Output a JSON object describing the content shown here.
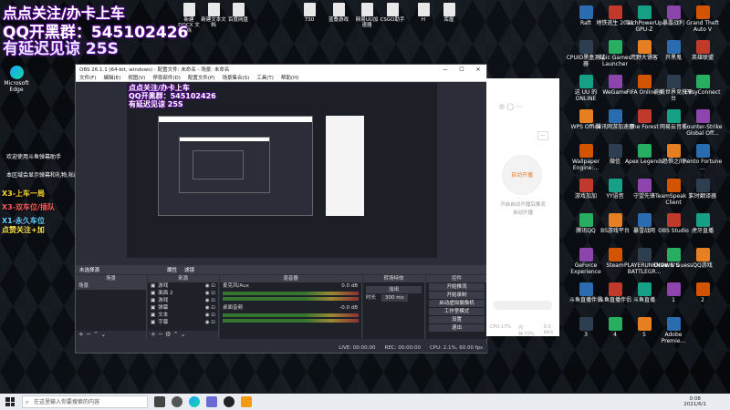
{
  "overlay": {
    "line1": "点点关注/办卡上车",
    "line2": "QQ开黑群：545102426",
    "line3": "有延迟见谅 25S"
  },
  "top_files": [
    {
      "label": "新建 DOCX 文档"
    },
    {
      "label": "新建文本文档"
    },
    {
      "label": "百度网盘"
    },
    {
      "label": "730"
    },
    {
      "label": "蓝叠游戏"
    },
    {
      "label": "网易UU加速器"
    },
    {
      "label": "CSGO助手"
    },
    {
      "label": "H"
    },
    {
      "label": "库屋"
    }
  ],
  "left_icons": [
    {
      "label": "Microsoft Edge"
    }
  ],
  "right_icons": [
    {
      "label": "Raft"
    },
    {
      "label": "地铁逃生 2021"
    },
    {
      "label": "TechPowerUp GPU-Z"
    },
    {
      "label": "暴露战利"
    },
    {
      "label": "Grand Theft Auto V"
    },
    {
      "label": "CPUID黑盒测试器"
    },
    {
      "label": "Epic Games Launcher"
    },
    {
      "label": "荒野大镖客"
    },
    {
      "label": "开黑鬼"
    },
    {
      "label": "英雄联盟"
    },
    {
      "label": "这 UU 的 ONLINE"
    },
    {
      "label": "WeGame"
    },
    {
      "label": "FIFA Online 4"
    },
    {
      "label": "完美世界竞技平台"
    },
    {
      "label": "EasyConnect"
    },
    {
      "label": "WPS Office"
    },
    {
      "label": "腾讯网游加速器"
    },
    {
      "label": "The Forest"
    },
    {
      "label": "网易云音乐"
    },
    {
      "label": "Counter-Strike Global Off..."
    },
    {
      "label": "Wallpaper Engine:..."
    },
    {
      "label": "微信"
    },
    {
      "label": "Apex Legends"
    },
    {
      "label": "恐惧之间"
    },
    {
      "label": "Rento Fortune ..."
    },
    {
      "label": "游戏加加"
    },
    {
      "label": "YY语音"
    },
    {
      "label": "守望先锋"
    },
    {
      "label": "TeamSpeak 3 Client"
    },
    {
      "label": "实时翻译器"
    },
    {
      "label": "腾讯QQ"
    },
    {
      "label": "BS游戏平台"
    },
    {
      "label": "暴雪战网"
    },
    {
      "label": "OBS Studio"
    },
    {
      "label": "虎牙直播"
    },
    {
      "label": "GeForce Experience"
    },
    {
      "label": "Steam"
    },
    {
      "label": "PLAYERUNKNOWN'S BATTLEGR..."
    },
    {
      "label": "Draw & Guess"
    },
    {
      "label": "QQ游戏"
    },
    {
      "label": "斗鱼直播伴侣"
    },
    {
      "label": "斗鱼直播伴侣"
    },
    {
      "label": "斗鱼直播"
    },
    {
      "label": "1"
    },
    {
      "label": "2"
    },
    {
      "label": "3"
    },
    {
      "label": "4"
    },
    {
      "label": "5"
    },
    {
      "label": "Adobe Premie..."
    }
  ],
  "chat": {
    "welcome": "欢迎使用斗鱼弹幕助手",
    "notice": "本区域会显示弹幕和礼物,帖间图"
  },
  "gifts": [
    {
      "text": "X3-上车一局",
      "color": "#ffd633"
    },
    {
      "text": "X3-双车位/插队",
      "color": "#ff5a5a"
    },
    {
      "text": "X1-永久车位",
      "color": "#66ccff"
    },
    {
      "text": "点赞关注+加",
      "color": "#ffe34d"
    }
  ],
  "obs": {
    "title": "OBS 26.1.1 (64-bit, windows) - 配置文件: 未命名 - 场景: 未命名",
    "menus": [
      "文件(F)",
      "编辑(E)",
      "视图(V)",
      "停靠部件(D)",
      "配置文件(P)",
      "场景集合(S)",
      "工具(T)",
      "帮助(H)"
    ],
    "source_bar": {
      "label": "未选择源",
      "props": "属性",
      "filters": "滤镜"
    },
    "scenes": {
      "header": "场景",
      "items": [
        "场景"
      ]
    },
    "sources": {
      "header": "来源",
      "items": [
        "游戏",
        "面面 2",
        "游戏",
        "弹幕",
        "文本",
        "字幕"
      ]
    },
    "mixer": {
      "header": "混音器",
      "channels": [
        {
          "name": "麦克风/Aux",
          "db": "0.0 dB"
        },
        {
          "name": "桌面音频",
          "db": "-0.0 dB"
        }
      ]
    },
    "transitions": {
      "header": "转场特效",
      "type": "淡出",
      "duration_label": "时长",
      "duration": "300 ms"
    },
    "controls": {
      "header": "控件",
      "buttons": [
        "开始推流",
        "开始录制",
        "启动虚拟摄像机",
        "工作室模式",
        "设置",
        "退出"
      ]
    },
    "status": {
      "live": "LIVE: 00:00:00",
      "rec": "REC: 00:00:00",
      "cpu": "CPU: 2.1%, 60.00 fps"
    }
  },
  "assist": {
    "center": "自动开播",
    "sub1": "开启自动开播后推流",
    "sub2": "自动开播",
    "footer_cpu": "CPU:17%",
    "footer_mem": "内存:72%",
    "footer_kbps": "0.0 kb/s"
  },
  "taskbar": {
    "search_placeholder": "在这里输入你要搜索的内容",
    "time": "0:08",
    "date": "2021/6/1"
  }
}
